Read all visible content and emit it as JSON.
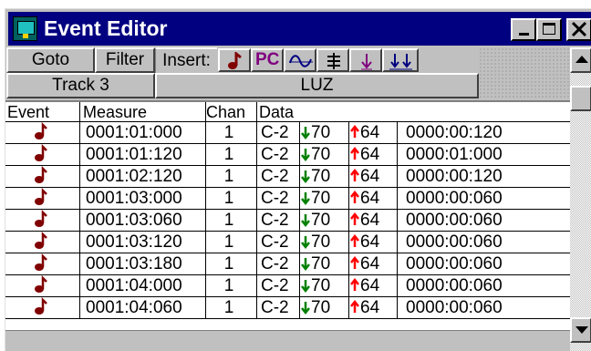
{
  "window": {
    "title": "Event Editor"
  },
  "title_buttons": [
    "minimize-icon",
    "maximize-icon",
    "close-icon"
  ],
  "toolbar": {
    "goto_label": "Goto",
    "filter_label": "Filter",
    "insert_label": "Insert:",
    "insert_buttons": [
      {
        "name": "note",
        "icon": "note-icon",
        "color": "#800000"
      },
      {
        "name": "program-change",
        "label": "PC",
        "color": "#800080"
      },
      {
        "name": "controller",
        "icon": "wave-icon",
        "color": "#000080"
      },
      {
        "name": "tempo",
        "icon": "tempo-icon",
        "color": "#000000"
      },
      {
        "name": "down-arrow",
        "icon": "down-arrow-icon",
        "color": "#800080"
      },
      {
        "name": "double-down-arrow",
        "icon": "double-down-arrow-icon",
        "color": "#000080"
      }
    ],
    "track_label": "Track 3",
    "track_name": "LUZ"
  },
  "columns": [
    "Event",
    "Measure",
    "Chan",
    "Data"
  ],
  "rows": [
    {
      "measure": "0001:01:000",
      "chan": "1",
      "note": "C-2",
      "vel_on": "70",
      "vel_off": "64",
      "duration": "0000:00:120"
    },
    {
      "measure": "0001:01:120",
      "chan": "1",
      "note": "C-2",
      "vel_on": "70",
      "vel_off": "64",
      "duration": "0000:01:000"
    },
    {
      "measure": "0001:02:120",
      "chan": "1",
      "note": "C-2",
      "vel_on": "70",
      "vel_off": "64",
      "duration": "0000:00:120"
    },
    {
      "measure": "0001:03:000",
      "chan": "1",
      "note": "C-2",
      "vel_on": "70",
      "vel_off": "64",
      "duration": "0000:00:060"
    },
    {
      "measure": "0001:03:060",
      "chan": "1",
      "note": "C-2",
      "vel_on": "70",
      "vel_off": "64",
      "duration": "0000:00:060"
    },
    {
      "measure": "0001:03:120",
      "chan": "1",
      "note": "C-2",
      "vel_on": "70",
      "vel_off": "64",
      "duration": "0000:00:060"
    },
    {
      "measure": "0001:03:180",
      "chan": "1",
      "note": "C-2",
      "vel_on": "70",
      "vel_off": "64",
      "duration": "0000:00:060"
    },
    {
      "measure": "0001:04:000",
      "chan": "1",
      "note": "C-2",
      "vel_on": "70",
      "vel_off": "64",
      "duration": "0000:00:060"
    },
    {
      "measure": "0001:04:060",
      "chan": "1",
      "note": "C-2",
      "vel_on": "70",
      "vel_off": "64",
      "duration": "0000:00:060"
    }
  ],
  "colors": {
    "title_bar": "#000080",
    "event_icon": "#800000",
    "velocity_on_arrow": "#008000",
    "velocity_off_arrow": "#ff0000"
  }
}
